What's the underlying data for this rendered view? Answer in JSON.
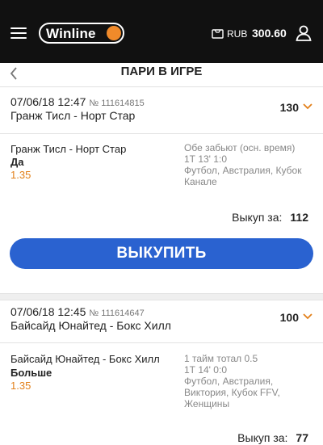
{
  "header": {
    "logo": "Winline",
    "currency": "RUB",
    "balance": "300.60"
  },
  "page": {
    "title": "ПАРИ В ИГРЕ"
  },
  "bets": [
    {
      "datetime": "07/06/18 12:47",
      "number": "№ 111614815",
      "match": "Гранж Тисл - Норт Стар",
      "stake": "130",
      "event": "Гранж Тисл - Норт Стар",
      "pick": "Да",
      "odds": "1.35",
      "market": "Обе забьют (осн. время)",
      "time": "1Т 13' 1:0",
      "league_lines": [
        "Футбол, Австралия, Кубок",
        "Канале"
      ],
      "cashout_label": "Выкуп за:",
      "cashout_value": "112",
      "button": "ВЫКУПИТЬ"
    },
    {
      "datetime": "07/06/18 12:45",
      "number": "№ 111614647",
      "match": "Байсайд Юнайтед - Бокс Хилл",
      "stake": "100",
      "event": "Байсайд Юнайтед - Бокс Хилл",
      "pick": "Больше",
      "odds": "1.35",
      "market": "1 тайм тотал 0.5",
      "time": "1Т 14' 0:0",
      "league_lines": [
        "Футбол, Австралия,",
        "Виктория, Кубок FFV,",
        "Женщины"
      ],
      "cashout_label": "Выкуп за:",
      "cashout_value": "77"
    }
  ]
}
